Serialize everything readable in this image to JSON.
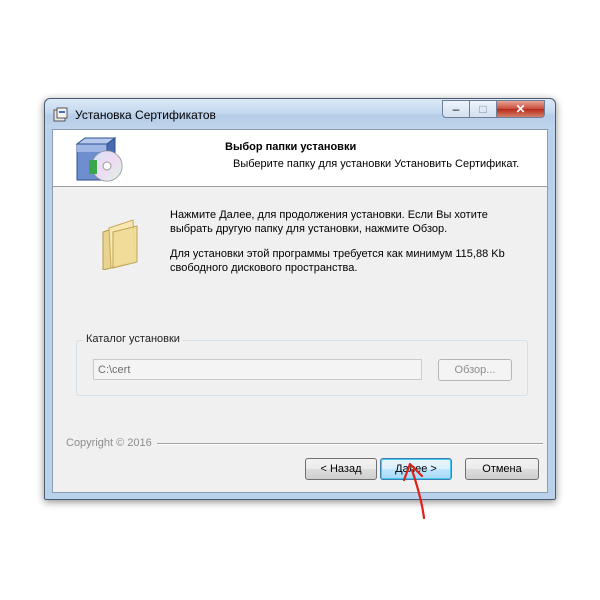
{
  "window": {
    "title": "Установка Сертификатов",
    "minimize_glyph": "–",
    "maximize_glyph": "□",
    "close_glyph": "✕"
  },
  "header": {
    "title": "Выбор папки установки",
    "subtitle": "Выберите папку для установки Установить Сертификат.",
    "icon": "installer-cd-box-icon"
  },
  "body": {
    "info_line1": "Нажмите Далее, для продолжения установки. Если Вы хотите",
    "info_line2": "выбрать другую папку для установки, нажмите Обзор.",
    "space_line1": "Для установки этой программы требуется как минимум 115,88 Kb",
    "space_line2": "свободного дискового пространства.",
    "folder_icon": "folder-icon"
  },
  "install_dir": {
    "label": "Каталог установки",
    "value": "C:\\cert",
    "browse_label": "Обзор..."
  },
  "footer": {
    "copyright": "Copyright © 2016",
    "back_label": "< Назад",
    "next_label": "Далее >",
    "cancel_label": "Отмена"
  },
  "annotation": {
    "icon": "red-arrow-icon",
    "color": "#e0201a"
  }
}
